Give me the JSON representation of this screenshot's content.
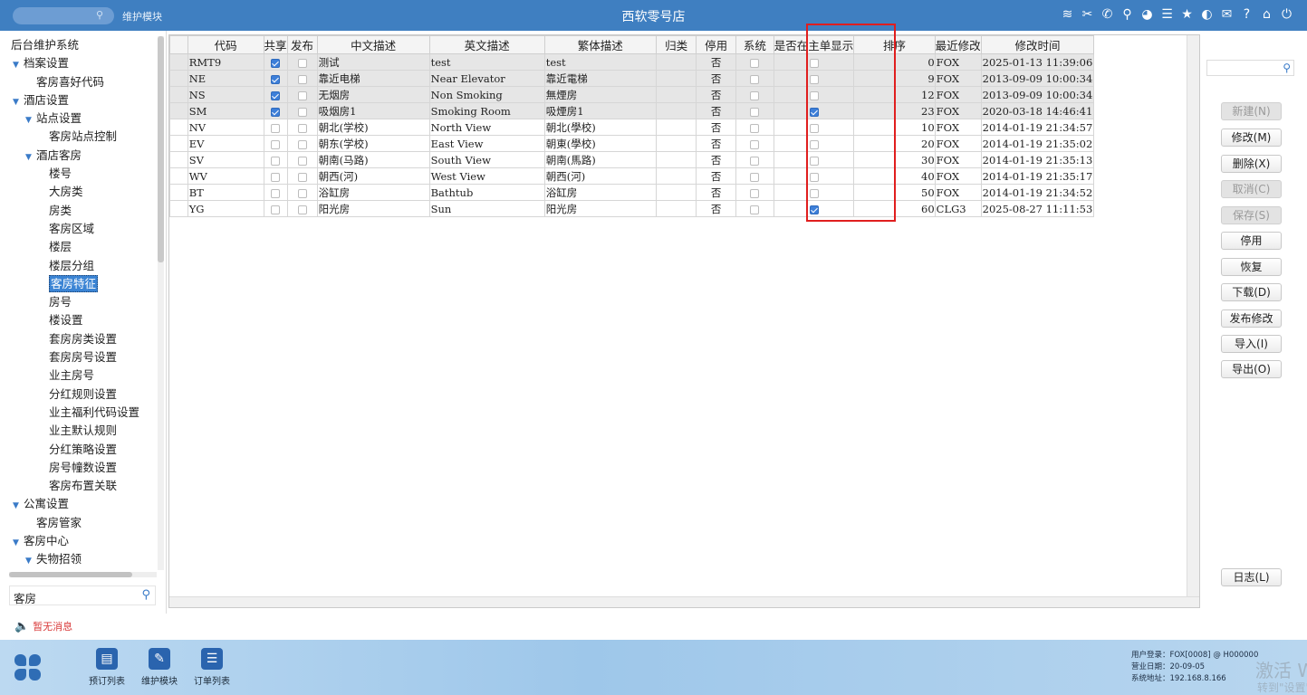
{
  "header": {
    "module_label": "维护模块",
    "title": "西软零号店",
    "icons": [
      "wifi-icon",
      "tools-icon",
      "phone-icon",
      "search-person-icon",
      "palette-icon",
      "menu-icon",
      "star-icon",
      "contrast-icon",
      "mail-icon",
      "help-icon",
      "home-icon",
      "power-icon"
    ]
  },
  "nav": {
    "items": [
      {
        "label": "后台维护系统",
        "level": 0,
        "arrow": false
      },
      {
        "label": "档案设置",
        "level": 0,
        "arrow": true
      },
      {
        "label": "客房喜好代码",
        "level": 1,
        "arrow": false
      },
      {
        "label": "酒店设置",
        "level": 0,
        "arrow": true
      },
      {
        "label": "站点设置",
        "level": 1,
        "arrow": true
      },
      {
        "label": "客房站点控制",
        "level": 2,
        "arrow": false
      },
      {
        "label": "酒店客房",
        "level": 1,
        "arrow": true
      },
      {
        "label": "楼号",
        "level": 2,
        "arrow": false
      },
      {
        "label": "大房类",
        "level": 2,
        "arrow": false
      },
      {
        "label": "房类",
        "level": 2,
        "arrow": false
      },
      {
        "label": "客房区域",
        "level": 2,
        "arrow": false
      },
      {
        "label": "楼层",
        "level": 2,
        "arrow": false
      },
      {
        "label": "楼层分组",
        "level": 2,
        "arrow": false
      },
      {
        "label": "客房特征",
        "level": 2,
        "arrow": false,
        "selected": true
      },
      {
        "label": "房号",
        "level": 2,
        "arrow": false
      },
      {
        "label": "楼设置",
        "level": 2,
        "arrow": false
      },
      {
        "label": "套房房类设置",
        "level": 2,
        "arrow": false
      },
      {
        "label": "套房房号设置",
        "level": 2,
        "arrow": false
      },
      {
        "label": "业主房号",
        "level": 2,
        "arrow": false
      },
      {
        "label": "分红规则设置",
        "level": 2,
        "arrow": false
      },
      {
        "label": "业主福利代码设置",
        "level": 2,
        "arrow": false
      },
      {
        "label": "业主默认规则",
        "level": 2,
        "arrow": false
      },
      {
        "label": "分红策略设置",
        "level": 2,
        "arrow": false
      },
      {
        "label": "房号幢数设置",
        "level": 2,
        "arrow": false
      },
      {
        "label": "客房布置关联",
        "level": 2,
        "arrow": false
      },
      {
        "label": "公寓设置",
        "level": 0,
        "arrow": true
      },
      {
        "label": "客房管家",
        "level": 1,
        "arrow": false
      },
      {
        "label": "客房中心",
        "level": 0,
        "arrow": true
      },
      {
        "label": "失物招领",
        "level": 1,
        "arrow": true
      }
    ],
    "search_value": "客房"
  },
  "table": {
    "columns": [
      "代码",
      "共享",
      "发布",
      "中文描述",
      "英文描述",
      "繁体描述",
      "归类",
      "停用",
      "系统",
      "是否在主单显示",
      "排序",
      "最近修改",
      "修改时间"
    ],
    "rows": [
      {
        "code": "RMT9",
        "share": true,
        "publish": false,
        "cn": "测试",
        "en": "test",
        "tw": "test",
        "cat": "",
        "disabled": "否",
        "system": false,
        "main": false,
        "sort": "0",
        "modby": "FOX",
        "time": "2025-01-13 11:39:06",
        "gray": true
      },
      {
        "code": "NE",
        "share": true,
        "publish": false,
        "cn": "靠近电梯",
        "en": "Near Elevator",
        "tw": "靠近電梯",
        "cat": "",
        "disabled": "否",
        "system": false,
        "main": false,
        "sort": "9",
        "modby": "FOX",
        "time": "2013-09-09 10:00:34",
        "gray": true
      },
      {
        "code": "NS",
        "share": true,
        "publish": false,
        "cn": "无烟房",
        "en": "Non Smoking",
        "tw": "無煙房",
        "cat": "",
        "disabled": "否",
        "system": false,
        "main": false,
        "sort": "12",
        "modby": "FOX",
        "time": "2013-09-09 10:00:34",
        "gray": true
      },
      {
        "code": "SM",
        "share": true,
        "publish": false,
        "cn": "吸烟房1",
        "en": "Smoking Room",
        "tw": "吸煙房1",
        "cat": "",
        "disabled": "否",
        "system": false,
        "main": true,
        "sort": "23",
        "modby": "FOX",
        "time": "2020-03-18 14:46:41",
        "gray": true
      },
      {
        "code": "NV",
        "share": false,
        "publish": false,
        "cn": "朝北(学校)",
        "en": "North View",
        "tw": "朝北(學校)",
        "cat": "",
        "disabled": "否",
        "system": false,
        "main": false,
        "sort": "10",
        "modby": "FOX",
        "time": "2014-01-19 21:34:57",
        "gray": false
      },
      {
        "code": "EV",
        "share": false,
        "publish": false,
        "cn": "朝东(学校)",
        "en": "East View",
        "tw": "朝東(學校)",
        "cat": "",
        "disabled": "否",
        "system": false,
        "main": false,
        "sort": "20",
        "modby": "FOX",
        "time": "2014-01-19 21:35:02",
        "gray": false
      },
      {
        "code": "SV",
        "share": false,
        "publish": false,
        "cn": "朝南(马路)",
        "en": "South View",
        "tw": "朝南(馬路)",
        "cat": "",
        "disabled": "否",
        "system": false,
        "main": false,
        "sort": "30",
        "modby": "FOX",
        "time": "2014-01-19 21:35:13",
        "gray": false
      },
      {
        "code": "WV",
        "share": false,
        "publish": false,
        "cn": "朝西(河)",
        "en": "West View",
        "tw": "朝西(河)",
        "cat": "",
        "disabled": "否",
        "system": false,
        "main": false,
        "sort": "40",
        "modby": "FOX",
        "time": "2014-01-19 21:35:17",
        "gray": false
      },
      {
        "code": "BT",
        "share": false,
        "publish": false,
        "cn": "浴缸房",
        "en": "Bathtub",
        "tw": "浴缸房",
        "cat": "",
        "disabled": "否",
        "system": false,
        "main": false,
        "sort": "50",
        "modby": "FOX",
        "time": "2014-01-19 21:34:52",
        "gray": false
      },
      {
        "code": "YG",
        "share": false,
        "publish": false,
        "cn": "阳光房",
        "en": "Sun",
        "tw": "阳光房",
        "cat": "",
        "disabled": "否",
        "system": false,
        "main": true,
        "sort": "60",
        "modby": "CLG3",
        "time": "2025-08-27 11:11:53",
        "gray": false
      }
    ]
  },
  "buttons": [
    {
      "label": "新建(N)",
      "name": "new-button",
      "disabled": true
    },
    {
      "label": "修改(M)",
      "name": "edit-button",
      "disabled": false
    },
    {
      "label": "删除(X)",
      "name": "delete-button",
      "disabled": false
    },
    {
      "label": "取消(C)",
      "name": "cancel-button",
      "disabled": true
    },
    {
      "label": "保存(S)",
      "name": "save-button",
      "disabled": true
    },
    {
      "label": "停用",
      "name": "deactivate-button",
      "disabled": false
    },
    {
      "label": "恢复",
      "name": "restore-button",
      "disabled": false
    },
    {
      "label": "下载(D)",
      "name": "download-button",
      "disabled": false
    },
    {
      "label": "发布修改",
      "name": "publish-changes-button",
      "disabled": false
    },
    {
      "label": "导入(I)",
      "name": "import-button",
      "disabled": false
    },
    {
      "label": "导出(O)",
      "name": "export-button",
      "disabled": false
    }
  ],
  "log_button": "日志(L)",
  "message": "暂无消息",
  "taskbar": {
    "apps": [
      {
        "label": "预订列表",
        "icon": "reservation-list-icon"
      },
      {
        "label": "维护模块",
        "icon": "maintenance-icon"
      },
      {
        "label": "订单列表",
        "icon": "order-list-icon"
      }
    ],
    "user": "用户登录：FOX[0008] @ H000000",
    "biz_date": "营业日期：20-09-05",
    "sys_addr": "系统地址：192.168.8.166",
    "watermark_line1": "激活 Windows",
    "watermark_line2": "转到\"设置\"以激活 Windows。"
  },
  "colors": {
    "topbar": "#3f7fc1",
    "selected": "#3b84d4",
    "checkbox_on": "#3d7fd9",
    "highlight_box": "#e01e1e",
    "message": "#d93a3a"
  }
}
